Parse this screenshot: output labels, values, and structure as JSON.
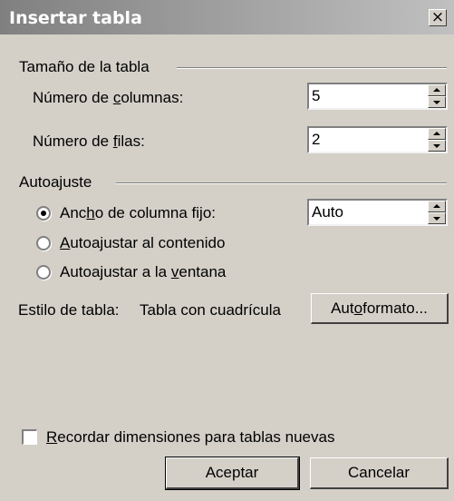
{
  "window": {
    "title": "Insertar tabla",
    "close_glyph": "×"
  },
  "size_group": {
    "label": "Tamaño de la tabla",
    "columns": {
      "label_pre": "Número de ",
      "label_key": "c",
      "label_post": "olumnas:",
      "value": "5"
    },
    "rows": {
      "label_pre": "Número de ",
      "label_key": "f",
      "label_post": "ilas:",
      "value": "2"
    }
  },
  "autofit_group": {
    "label": "Autoajuste",
    "options": [
      {
        "pre": "Anc",
        "key": "h",
        "post": "o de columna fijo:",
        "selected": true
      },
      {
        "pre": "",
        "key": "A",
        "post": "utoajustar al contenido",
        "selected": false
      },
      {
        "pre": "Autoajustar a la ",
        "key": "v",
        "post": "entana",
        "selected": false
      }
    ],
    "fixed_width_value": "Auto"
  },
  "style": {
    "label": "Estilo de tabla:",
    "value": "Tabla con cuadrícula",
    "autoformat_pre": "Aut",
    "autoformat_key": "o",
    "autoformat_post": "formato..."
  },
  "remember": {
    "key": "R",
    "post": "ecordar dimensiones para tablas nuevas",
    "checked": false
  },
  "buttons": {
    "ok": "Aceptar",
    "cancel": "Cancelar"
  },
  "colors": {
    "face": "#d4d0c8",
    "title_start": "#808080",
    "title_end": "#c0c0c0"
  }
}
